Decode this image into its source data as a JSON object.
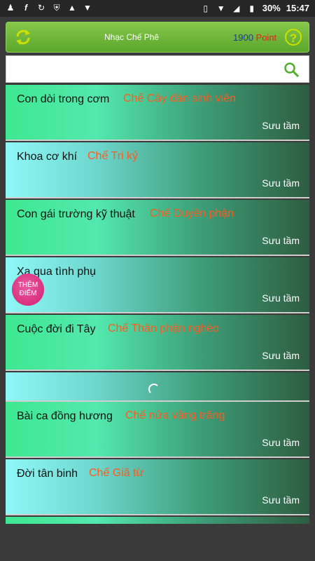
{
  "status_bar": {
    "left_icons": [
      "person-icon",
      "f-icon",
      "g-icon",
      "shield-icon",
      "warning-icon",
      "image-icon"
    ],
    "battery_pct": "30%",
    "time": "15:47"
  },
  "header": {
    "title": "Nhạc Chế Phê",
    "points_value": "1900",
    "points_unit": " Point",
    "help_label": "?"
  },
  "search": {
    "placeholder": "",
    "value": ""
  },
  "badge": {
    "line1": "THÊM",
    "line2": "ĐIỂM"
  },
  "songs": [
    {
      "title": "Con dòi trong cơm",
      "parody": "Chế Cây đàn sinh viên",
      "source": "Sưu tầm"
    },
    {
      "title": "Khoa cơ khí",
      "parody": "Chế Tri kỷ",
      "source": "Sưu tầm"
    },
    {
      "title": "Con gái trường kỹ thuật",
      "parody": "Chế Duyên phận",
      "source": "Sưu tầm"
    },
    {
      "title": "Xa qua tình phụ",
      "parody": "",
      "source": "Sưu tầm"
    },
    {
      "title": "Cuộc đời đi Tây",
      "parody": "Chế Thân phận nghèo",
      "source": "Sưu tầm"
    },
    {
      "title": "Bài ca đồng hương",
      "parody": "Chế nửa vầng trăng",
      "source": "Sưu tầm"
    },
    {
      "title": "Đời tân binh",
      "parody": "Chế Giã từ",
      "source": "Sưu tầm"
    }
  ],
  "colors": {
    "header_green": "#6cb83a",
    "parody_orange": "#ff5a1f",
    "points_blue": "#1e3c8c",
    "points_red": "#e82020"
  }
}
